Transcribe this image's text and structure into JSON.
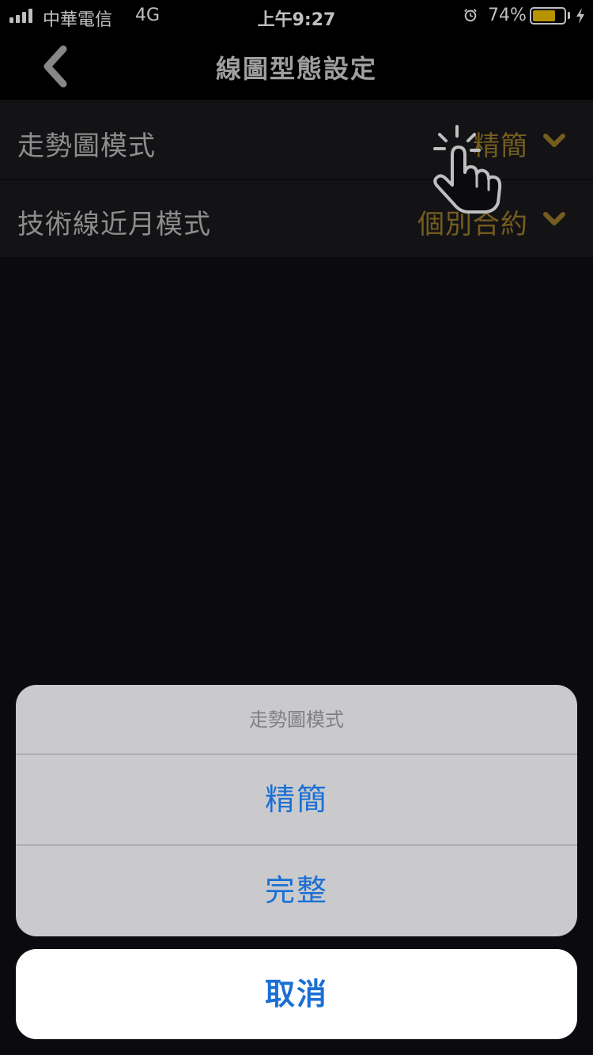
{
  "status_bar": {
    "carrier": "中華電信",
    "network": "4G",
    "time": "上午9:27",
    "battery_percent": "74%",
    "battery_level": 0.74,
    "battery_color": "#f5c400",
    "icons": [
      "signal-icon",
      "alarm-icon",
      "battery-icon",
      "charging-bolt-icon"
    ]
  },
  "nav": {
    "title": "線圖型態設定",
    "back_icon": "chevron-left-icon"
  },
  "settings": [
    {
      "label": "走勢圖模式",
      "value": "精簡"
    },
    {
      "label": "技術線近月模式",
      "value": "個別合約"
    }
  ],
  "action_sheet": {
    "title": "走勢圖模式",
    "options": [
      "精簡",
      "完整"
    ],
    "cancel_label": "取消"
  },
  "colors": {
    "accent_gold": "#9c7c2a",
    "action_blue": "#1a6fd4",
    "background": "#0f0f14"
  }
}
